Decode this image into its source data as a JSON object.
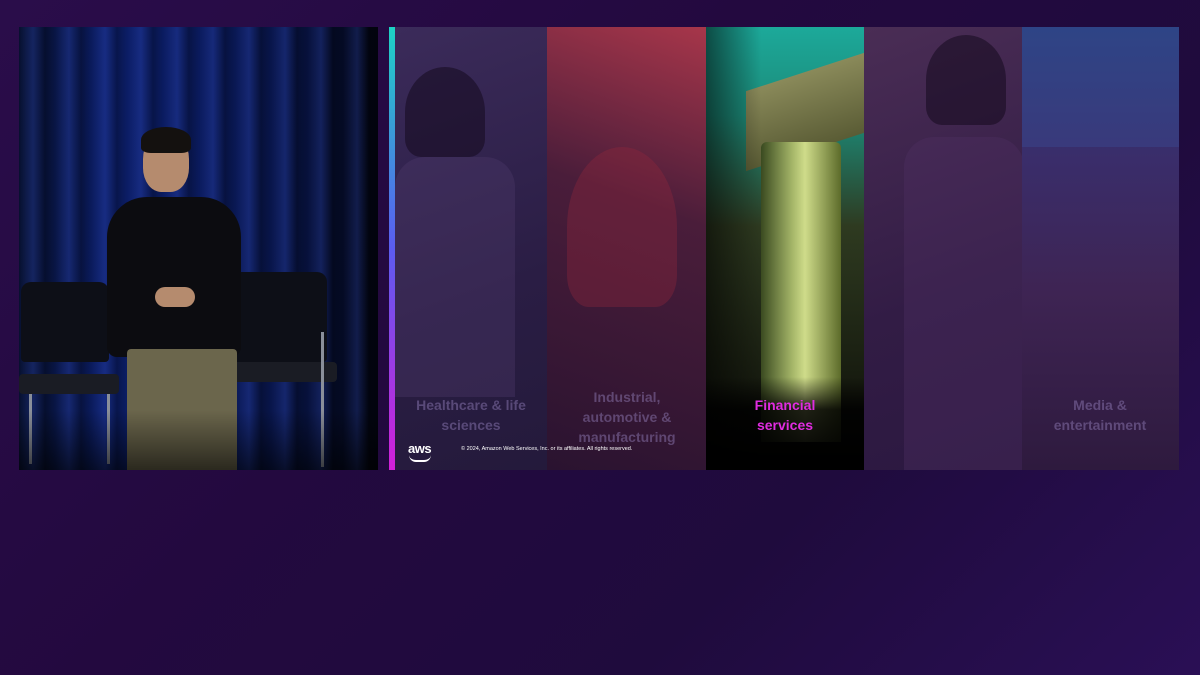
{
  "slide": {
    "panels": [
      {
        "label": "Healthcare & life sciences",
        "highlighted": false
      },
      {
        "label": "Industrial, automotive & manufacturing",
        "highlighted": false
      },
      {
        "label": "Financial services",
        "highlighted": true
      },
      {
        "label": "",
        "highlighted": false
      },
      {
        "label": "Media & entertainment",
        "highlighted": false
      }
    ],
    "logo_text": "aws",
    "copyright": "© 2024, Amazon Web Services, Inc. or its affiliates. All rights reserved.",
    "accent_colors": {
      "teal": "#1dd3c4",
      "magenta": "#e02ce0"
    }
  },
  "speaker_feed": {
    "icons": [
      "presenter-figure",
      "stage-chair",
      "stage-chair"
    ]
  }
}
